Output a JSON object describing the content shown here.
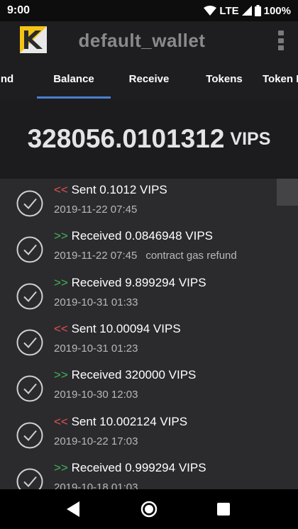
{
  "status_bar": {
    "time": "9:00",
    "network": "LTE",
    "battery": "100%"
  },
  "app_bar": {
    "title": "default_wallet"
  },
  "tabs": [
    {
      "label": "nd"
    },
    {
      "label": "Balance",
      "selected": true
    },
    {
      "label": "Receive"
    },
    {
      "label": "Tokens"
    },
    {
      "label": "Token I"
    }
  ],
  "balance": {
    "amount": "328056.0101312",
    "unit": "VIPS"
  },
  "transactions": [
    {
      "direction": "<<",
      "type": "sent",
      "text": "Sent 0.1012 VIPS",
      "datetime": "2019-11-22 07:45",
      "note": ""
    },
    {
      "direction": ">>",
      "type": "received",
      "text": "Received 0.0846948 VIPS",
      "datetime": "2019-11-22 07:45",
      "note": "contract gas refund"
    },
    {
      "direction": ">>",
      "type": "received",
      "text": "Received 9.899294 VIPS",
      "datetime": "2019-10-31 01:33",
      "note": ""
    },
    {
      "direction": "<<",
      "type": "sent",
      "text": "Sent 10.00094 VIPS",
      "datetime": "2019-10-31 01:23",
      "note": ""
    },
    {
      "direction": ">>",
      "type": "received",
      "text": "Received 320000 VIPS",
      "datetime": "2019-10-30 12:03",
      "note": ""
    },
    {
      "direction": "<<",
      "type": "sent",
      "text": "Sent 10.002124 VIPS",
      "datetime": "2019-10-22 17:03",
      "note": ""
    },
    {
      "direction": ">>",
      "type": "received",
      "text": "Received 0.999294 VIPS",
      "datetime": "2019-10-18 01:03",
      "note": ""
    }
  ],
  "colors": {
    "sent": "#e05050",
    "received": "#3fb55a",
    "accent": "#4a7fd0"
  },
  "icons": {
    "wifi": "wifi-icon",
    "signal": "signal-icon",
    "battery": "battery-icon",
    "logo": "wallet-logo",
    "menu": "more-vert-icon",
    "check": "check-circle-icon"
  }
}
